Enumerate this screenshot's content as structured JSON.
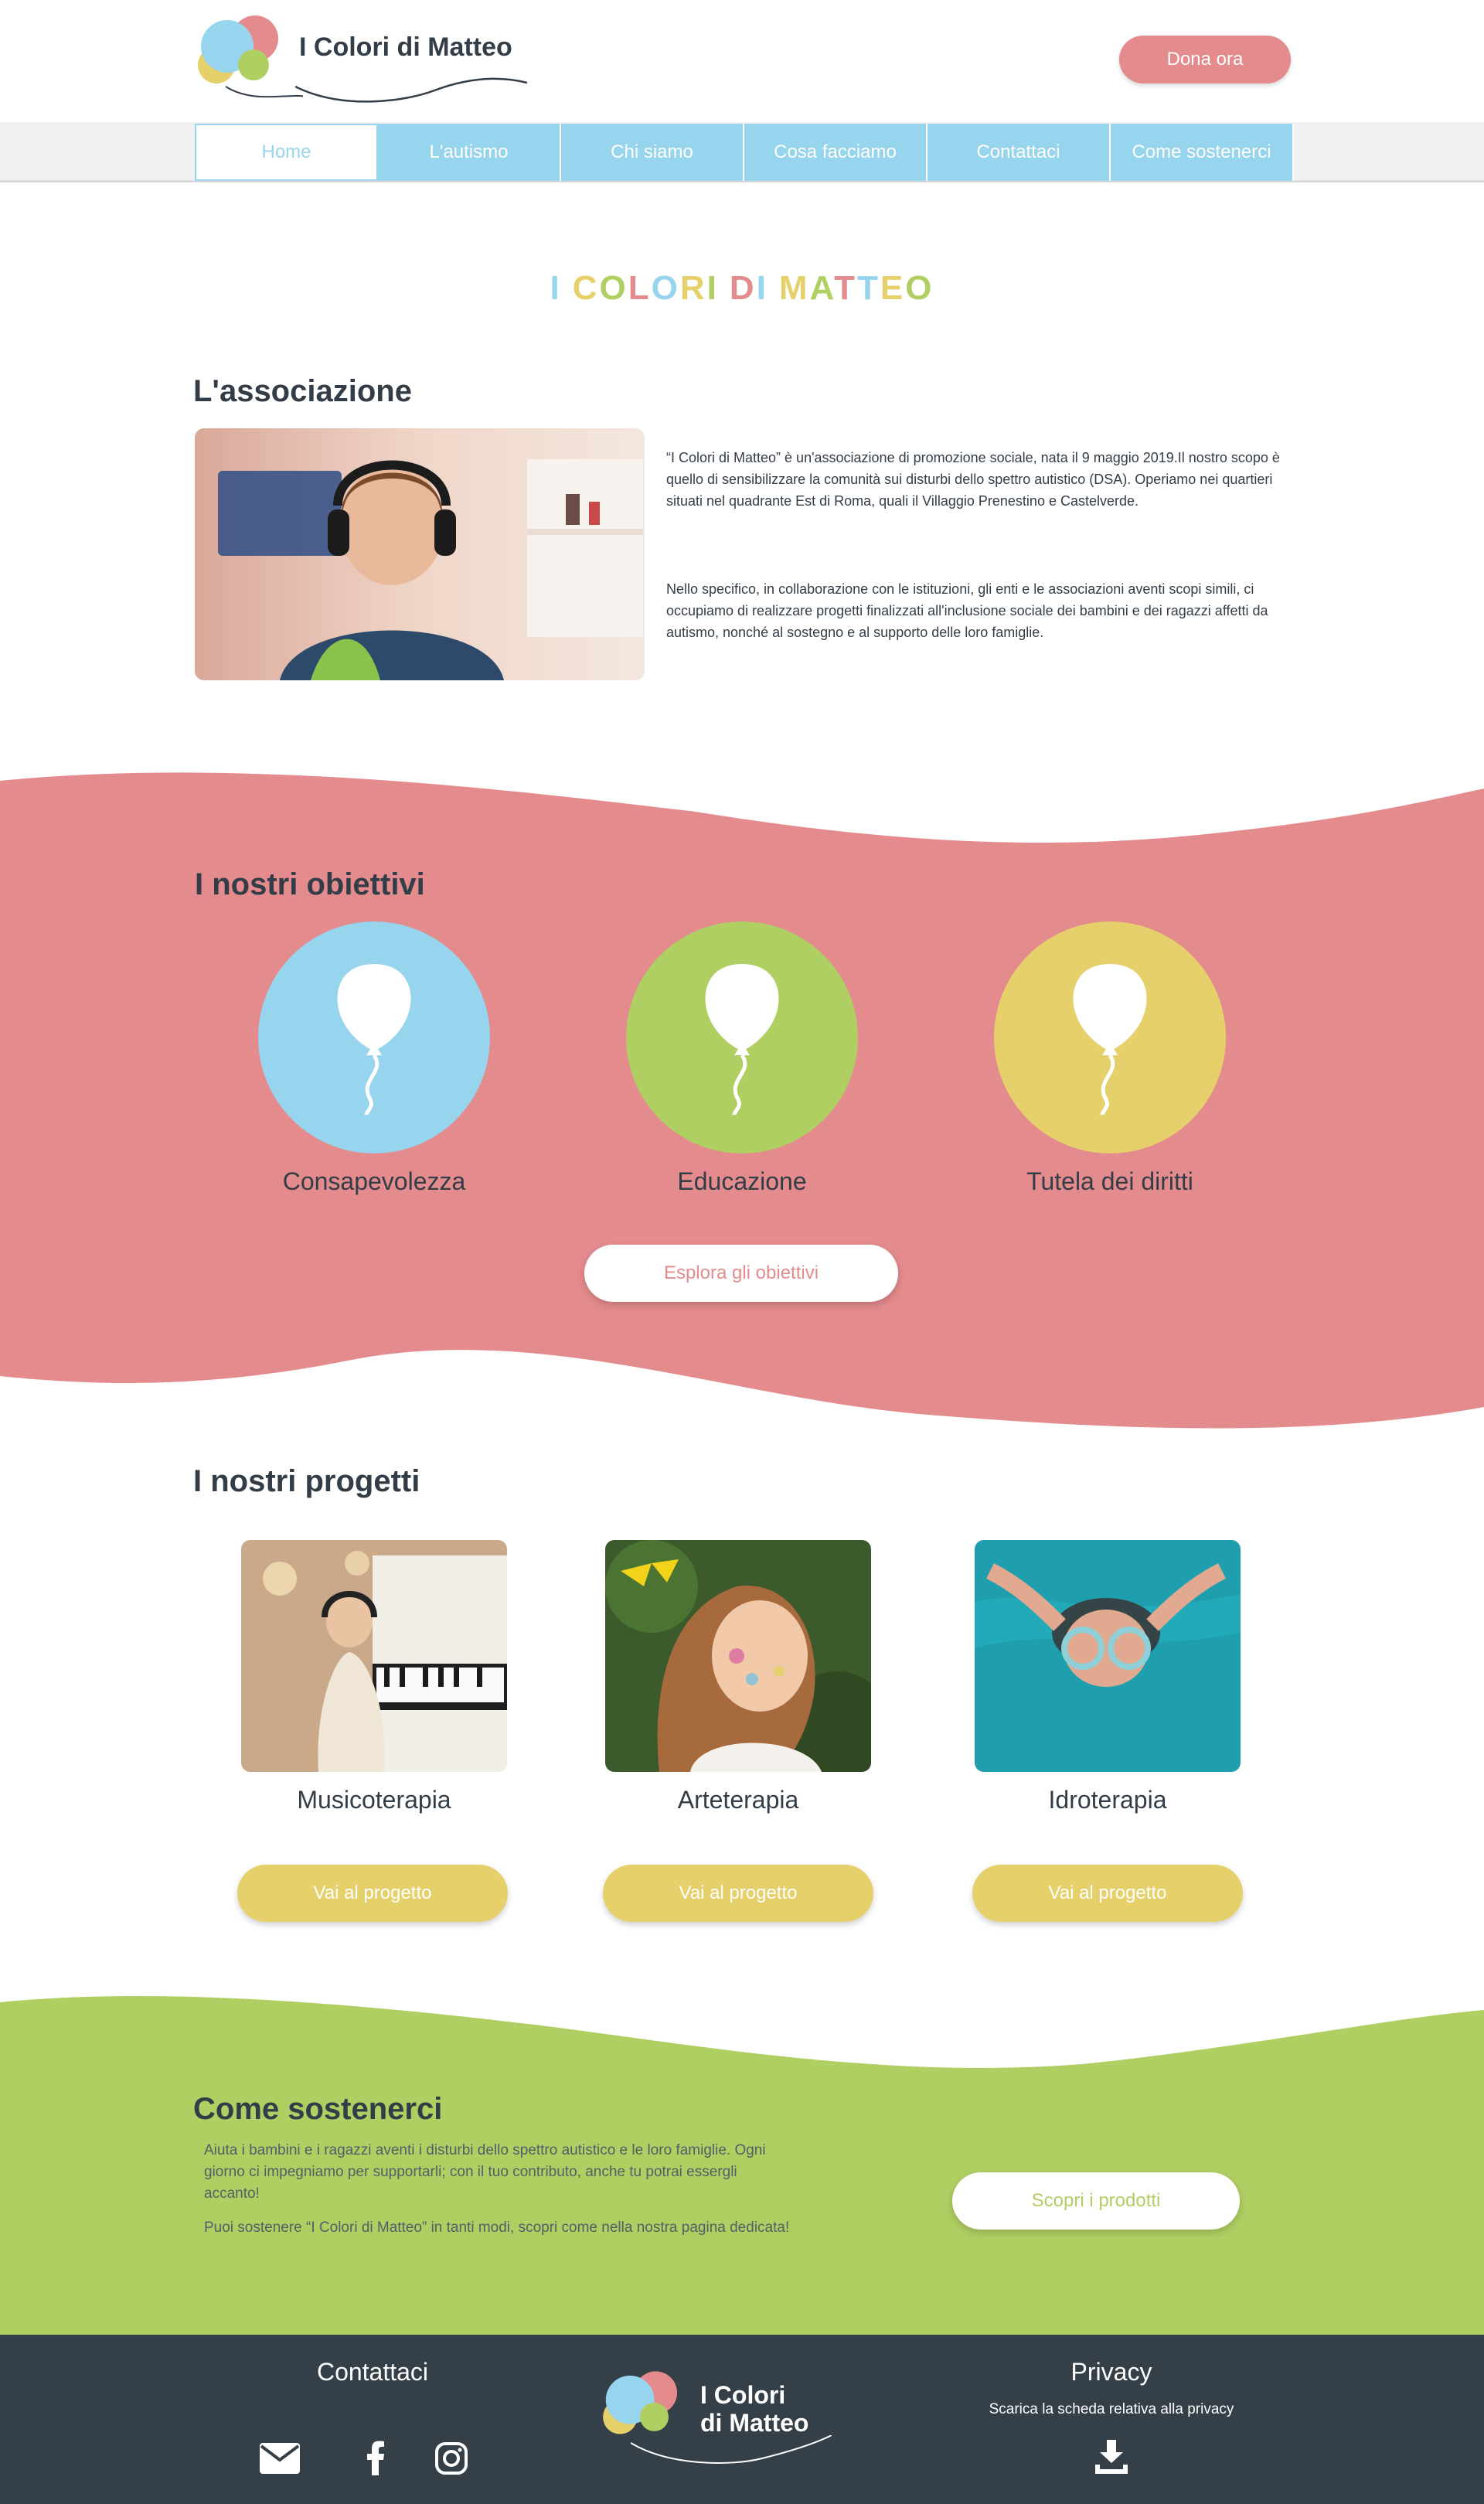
{
  "header": {
    "brand": "I Colori di Matteo",
    "donate_label": "Dona ora"
  },
  "nav": {
    "items": [
      {
        "label": "Home",
        "active": true
      },
      {
        "label": "L'autismo"
      },
      {
        "label": "Chi siamo"
      },
      {
        "label": "Cosa facciamo"
      },
      {
        "label": "Contattaci"
      },
      {
        "label": "Come sostenerci"
      }
    ]
  },
  "hero": {
    "title_letters": [
      "I",
      " ",
      "C",
      "O",
      "L",
      "O",
      "R",
      "I",
      " ",
      "D",
      "I",
      " ",
      "M",
      "A",
      "T",
      "T",
      "E",
      "O"
    ]
  },
  "association": {
    "heading": "L'associazione",
    "paragraph1": "“I Colori di Matteo” è un'associazione di promozione sociale, nata il 9 maggio 2019.Il nostro scopo è quello di sensibilizzare la comunità sui disturbi dello spettro autistico (DSA). Operiamo nei quartieri situati nel quadrante Est di Roma, quali il Villaggio Prenestino e Castelverde.",
    "paragraph2": "Nello specifico, in collaborazione con le istituzioni, gli enti e le associazioni aventi scopi simili, ci occupiamo di realizzare progetti finalizzati all'inclusione sociale dei bambini e dei ragazzi affetti da autismo, nonché al sostegno e al supporto delle loro famiglie."
  },
  "objectives": {
    "heading": "I nostri obiettivi",
    "items": [
      {
        "label": "Consapevolezza",
        "icon": "balloon-icon",
        "color": "#97d4ee"
      },
      {
        "label": "Educazione",
        "icon": "balloon-icon",
        "color": "#b0cf63"
      },
      {
        "label": "Tutela dei diritti",
        "icon": "balloon-icon",
        "color": "#e6d06c"
      }
    ],
    "button_label": "Esplora gli obiettivi"
  },
  "projects": {
    "heading": "I nostri progetti",
    "items": [
      {
        "title": "Musicoterapia",
        "button": "Vai al progetto"
      },
      {
        "title": "Arteterapia",
        "button": "Vai al progetto"
      },
      {
        "title": "Idroterapia",
        "button": "Vai al progetto"
      }
    ]
  },
  "support": {
    "heading": "Come sostenerci",
    "paragraph1": "Aiuta i bambini e i ragazzi aventi i disturbi dello spettro autistico e le loro famiglie. Ogni giorno ci impegniamo per supportarli; con il tuo contributo, anche tu potrai essergli accanto!",
    "paragraph2": "Puoi sostenere “I Colori di Matteo” in tanti modi, scopri come nella nostra pagina dedicata!",
    "button_label": "Scopri i prodotti"
  },
  "footer": {
    "contact_title": "Contattaci",
    "brand_line1": "I Colori",
    "brand_line2": "di Matteo",
    "privacy_title": "Privacy",
    "privacy_text": "Scarica la scheda relativa alla privacy"
  },
  "colors": {
    "pink": "#e48b8d",
    "blue": "#97d4ee",
    "green": "#b0cf63",
    "yellow": "#e6d06c",
    "dark": "#353f48"
  }
}
